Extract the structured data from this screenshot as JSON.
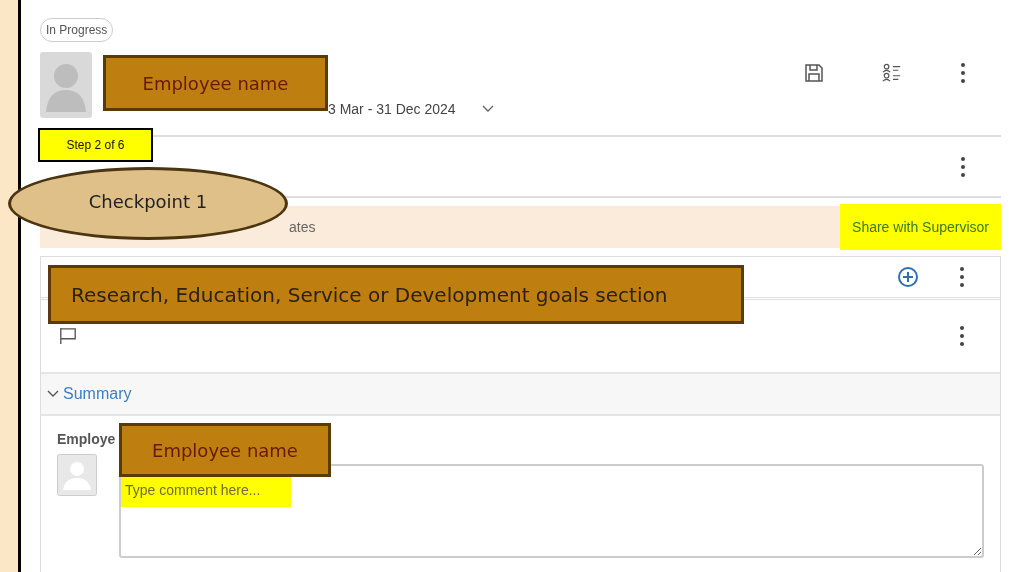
{
  "status_badge": "In Progress",
  "header": {
    "period": "3 Mar - 31 Dec 2024"
  },
  "banner": {
    "text": "ates",
    "share_button": {
      "label": "Share with Supervisor",
      "highlighted": true
    }
  },
  "summary": {
    "label": "Summary",
    "expanded": true
  },
  "comment": {
    "label": "Employe",
    "placeholder": "Type comment here...",
    "highlighted": true
  },
  "callouts": [
    {
      "kind": "box",
      "text": "Employee name"
    },
    {
      "kind": "step",
      "text": "Step 2 of 6"
    },
    {
      "kind": "ellipse",
      "text": "Checkpoint 1"
    },
    {
      "kind": "box",
      "text": "Research, Education, Service or Development goals section"
    },
    {
      "kind": "box",
      "text": "Employee name"
    }
  ]
}
